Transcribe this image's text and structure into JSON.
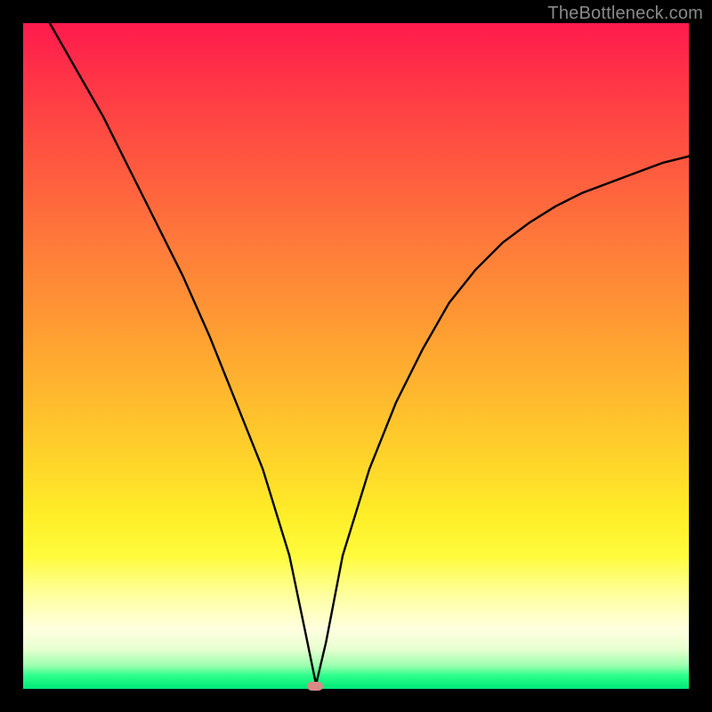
{
  "watermark": "TheBottleneck.com",
  "marker": {
    "x_frac": 0.438,
    "y_frac": 0.996
  },
  "chart_data": {
    "type": "line",
    "title": "",
    "xlabel": "",
    "ylabel": "",
    "xlim": [
      0,
      1
    ],
    "ylim": [
      0,
      1
    ],
    "note": "Normalized axes; x = component scale, y = bottleneck magnitude (0 at green bottom, 1 at red top). V-shaped curve with minimum near x≈0.44.",
    "series": [
      {
        "name": "bottleneck-curve",
        "x": [
          0.04,
          0.08,
          0.12,
          0.16,
          0.2,
          0.24,
          0.28,
          0.32,
          0.36,
          0.4,
          0.425,
          0.44,
          0.455,
          0.48,
          0.52,
          0.56,
          0.6,
          0.64,
          0.68,
          0.72,
          0.76,
          0.8,
          0.84,
          0.88,
          0.92,
          0.96,
          1.0
        ],
        "y": [
          1.0,
          0.93,
          0.86,
          0.78,
          0.7,
          0.62,
          0.53,
          0.43,
          0.33,
          0.2,
          0.08,
          0.0,
          0.07,
          0.2,
          0.33,
          0.43,
          0.51,
          0.58,
          0.63,
          0.67,
          0.7,
          0.725,
          0.745,
          0.76,
          0.775,
          0.79,
          0.8
        ]
      }
    ],
    "gradient_stops": [
      {
        "pos": 0.0,
        "color": "#ff1a4d"
      },
      {
        "pos": 0.5,
        "color": "#ffb92e"
      },
      {
        "pos": 0.8,
        "color": "#fffb3c"
      },
      {
        "pos": 0.95,
        "color": "#9dffb0"
      },
      {
        "pos": 1.0,
        "color": "#00e878"
      }
    ]
  }
}
